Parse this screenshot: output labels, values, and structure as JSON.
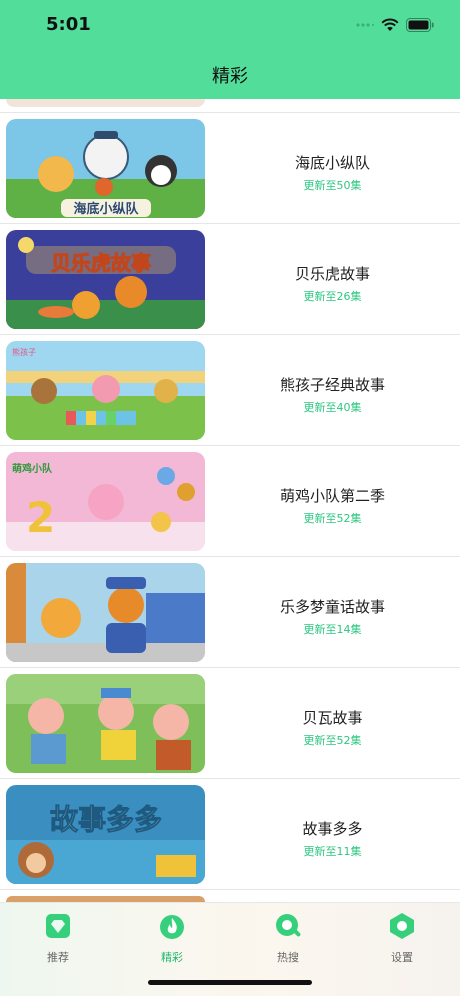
{
  "status_bar": {
    "time": "5:01"
  },
  "nav": {
    "title": "精彩"
  },
  "list": {
    "items": [
      {
        "title": "海底小纵队",
        "subtitle": "更新至50集",
        "thumb_caption": "海底小纵队"
      },
      {
        "title": "贝乐虎故事",
        "subtitle": "更新至26集",
        "thumb_caption": "贝乐虎故事"
      },
      {
        "title": "熊孩子经典故事",
        "subtitle": "更新至40集",
        "thumb_caption": "熊孩子"
      },
      {
        "title": "萌鸡小队第二季",
        "subtitle": "更新至52集",
        "thumb_caption": "萌鸡小队"
      },
      {
        "title": "乐多梦童话故事",
        "subtitle": "更新至14集",
        "thumb_caption": ""
      },
      {
        "title": "贝瓦故事",
        "subtitle": "更新至52集",
        "thumb_caption": ""
      },
      {
        "title": "故事多多",
        "subtitle": "更新至11集",
        "thumb_caption": "故事多多"
      }
    ]
  },
  "tabbar": {
    "tabs": [
      {
        "label": "推荐",
        "icon": "diamond-icon"
      },
      {
        "label": "精彩",
        "icon": "flame-icon"
      },
      {
        "label": "热搜",
        "icon": "search-icon"
      },
      {
        "label": "设置",
        "icon": "hexagon-gear-icon"
      }
    ],
    "active": "精彩"
  },
  "colors": {
    "accent": "#52de9a",
    "subtitle": "#2cc781"
  }
}
